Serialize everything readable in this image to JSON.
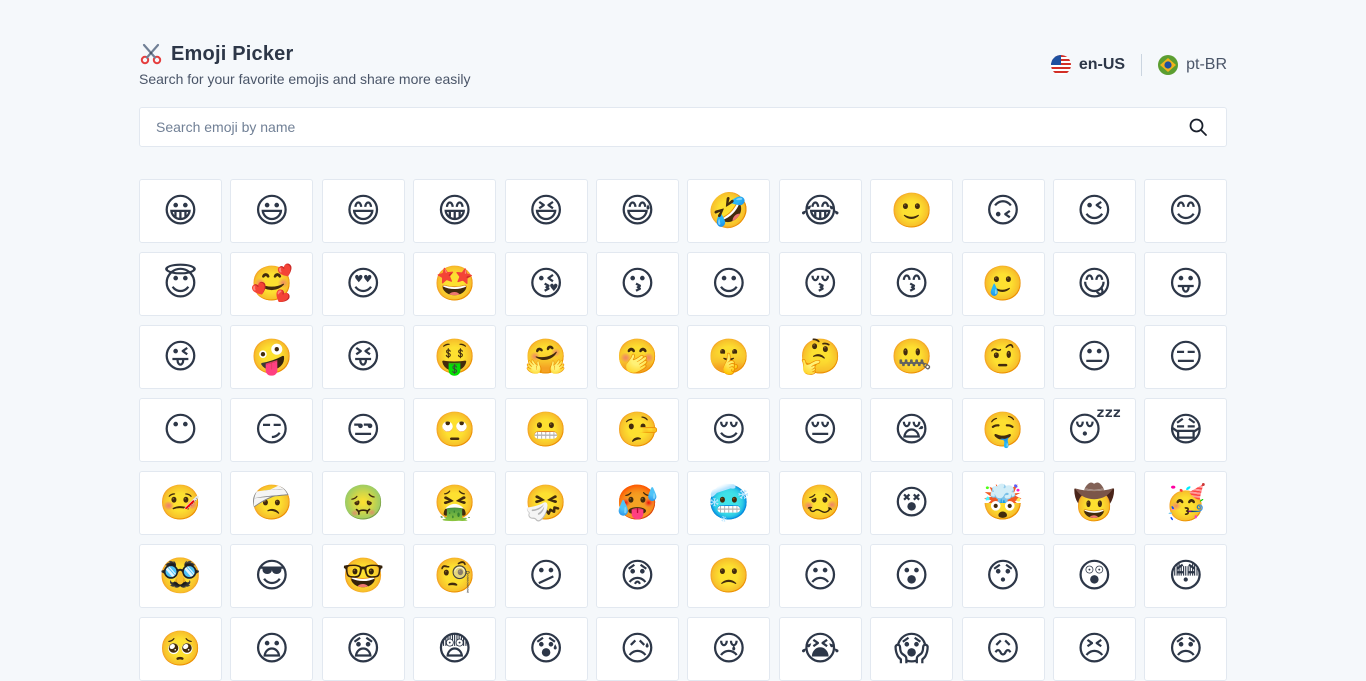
{
  "header": {
    "title": "Emoji Picker",
    "logo_icon": "scissors-icon",
    "subtitle": "Search for your favorite emojis and share more easily"
  },
  "languages": [
    {
      "code": "en-US",
      "flag": "us-flag-icon",
      "active": true
    },
    {
      "code": "pt-BR",
      "flag": "brazil-flag-icon",
      "active": false
    }
  ],
  "search": {
    "placeholder": "Search emoji by name",
    "value": "",
    "icon": "search-icon"
  },
  "colors": {
    "background": "#f5f8fb",
    "cell_border": "#e2e8f0",
    "text_primary": "#2d3748"
  },
  "emojis": [
    "😀",
    "😃",
    "😄",
    "😁",
    "😆",
    "😅",
    "🤣",
    "😂",
    "🙂",
    "🙃",
    "😉",
    "😊",
    "😇",
    "🥰",
    "😍",
    "🤩",
    "😘",
    "😗",
    "☺",
    "😚",
    "😙",
    "🥲",
    "😋",
    "😛",
    "😜",
    "🤪",
    "😝",
    "🤑",
    "🤗",
    "🤭",
    "🤫",
    "🤔",
    "🤐",
    "🤨",
    "😐",
    "😑",
    "😶",
    "😏",
    "😒",
    "🙄",
    "😬",
    "🤥",
    "😌",
    "😔",
    "😪",
    "🤤",
    "😴",
    "😷",
    "🤒",
    "🤕",
    "🤢",
    "🤮",
    "🤧",
    "🥵",
    "🥶",
    "🥴",
    "😵",
    "🤯",
    "🤠",
    "🥳",
    "🥸",
    "😎",
    "🤓",
    "🧐",
    "😕",
    "😟",
    "🙁",
    "☹",
    "😮",
    "😯",
    "😲",
    "😳",
    "🥺",
    "😦",
    "😧",
    "😨",
    "😰",
    "😥",
    "😢",
    "😭",
    "😱",
    "😖",
    "😣",
    "😞"
  ]
}
